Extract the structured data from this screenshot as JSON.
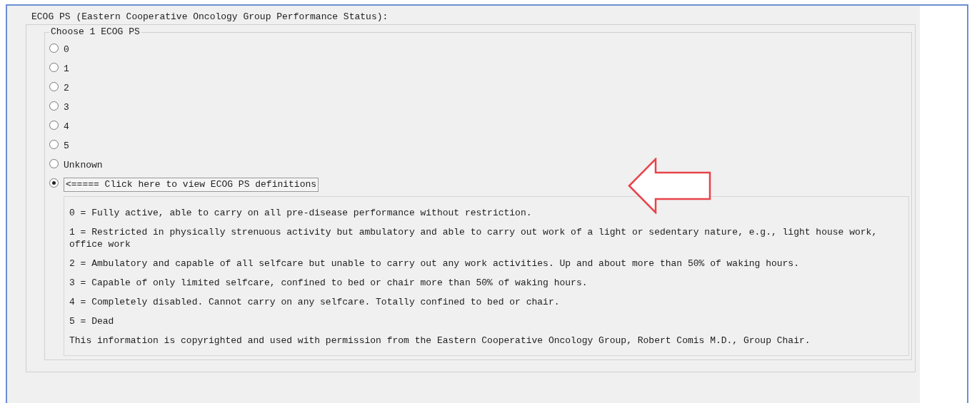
{
  "section_title": "ECOG PS (Eastern Cooperative Oncology Group Performance Status):",
  "group_legend": "Choose 1 ECOG PS",
  "options": [
    {
      "kind": "label",
      "label": "0",
      "selected": false
    },
    {
      "kind": "label",
      "label": "1",
      "selected": false
    },
    {
      "kind": "label",
      "label": "2",
      "selected": false
    },
    {
      "kind": "label",
      "label": "3",
      "selected": false
    },
    {
      "kind": "label",
      "label": "4",
      "selected": false
    },
    {
      "kind": "label",
      "label": "5",
      "selected": false
    },
    {
      "kind": "label",
      "label": "Unknown",
      "selected": false
    },
    {
      "kind": "button",
      "label": "<===== Click here to view ECOG PS definitions",
      "selected": true
    }
  ],
  "definitions": [
    "0 = Fully active, able to carry on all pre-disease performance without restriction.",
    "1 = Restricted in physically strenuous activity but ambulatory and able to carry out work of a light or sedentary nature, e.g., light house work, office work",
    "2 = Ambulatory and capable of all selfcare but unable to carry out any work activities. Up and about more than 50% of waking hours.",
    "3 = Capable of only limited selfcare, confined to bed or chair more than 50% of waking hours.",
    "4 = Completely disabled. Cannot carry on any selfcare. Totally confined to bed or chair.",
    "5 = Dead",
    "This information is copyrighted and used with permission from the Eastern Cooperative Oncology Group, Robert Comis M.D., Group Chair."
  ]
}
